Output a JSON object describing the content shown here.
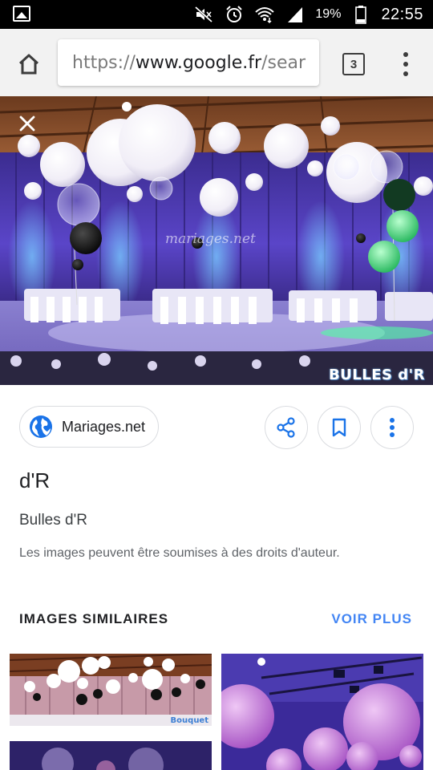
{
  "status_bar": {
    "battery_percent": "19%",
    "time": "22:55",
    "icons": [
      "gallery-icon",
      "mute-icon",
      "alarm-icon",
      "wifi-icon",
      "signal-icon",
      "battery-icon"
    ]
  },
  "browser": {
    "url_scheme": "https://",
    "url_host": "www.google.fr",
    "url_path": "/sear",
    "tab_count": "3",
    "icons": [
      "home-icon",
      "tabs-icon",
      "more-vert-icon"
    ]
  },
  "viewer": {
    "image_watermark": "mariages.net",
    "image_logo": "BULLES d'R",
    "source_label": "Mariages.net",
    "title": "d'R",
    "subtitle": "Bulles d'R",
    "copyright_notice": "Les images peuvent être soumises à des droits d'auteur.",
    "icons": [
      "close-icon",
      "globe-icon",
      "share-icon",
      "bookmark-icon",
      "more-vert-icon"
    ]
  },
  "similar": {
    "heading": "IMAGES SIMILAIRES",
    "see_more": "VOIR PLUS",
    "thumb_logo": "Bouquet"
  },
  "colors": {
    "accent_blue": "#4285f4",
    "chip_border": "#dadce0",
    "toolbar_bg": "#f2f2f2",
    "hall_purple": "#4b36a8"
  }
}
